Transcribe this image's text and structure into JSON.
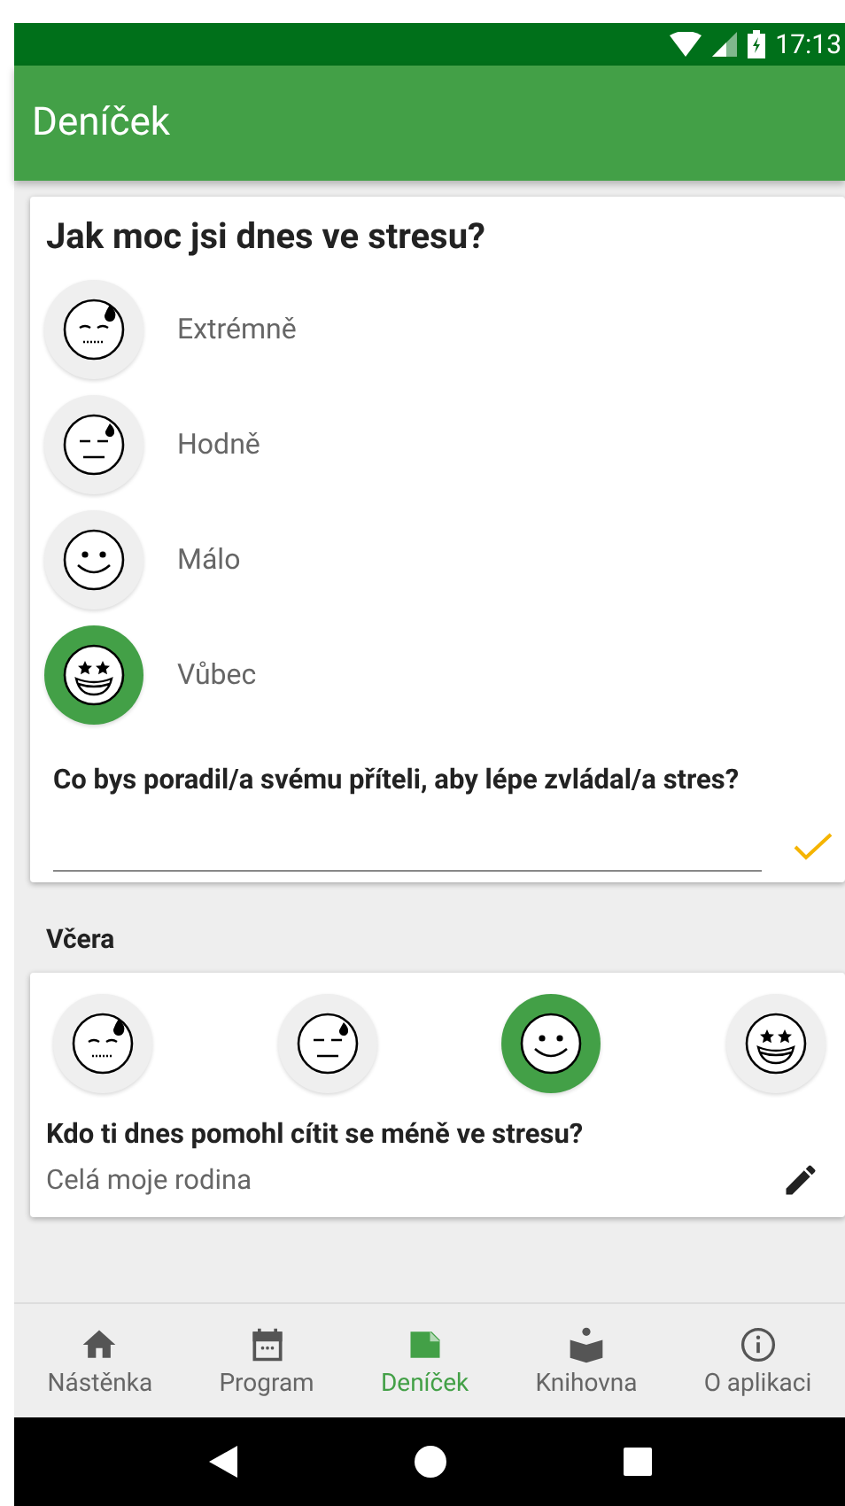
{
  "status_bar": {
    "time": "17:13"
  },
  "app_bar": {
    "title": "Deníček"
  },
  "today": {
    "question": "Jak moc jsi dnes ve stresu?",
    "options": [
      {
        "kind": "extreme",
        "label": "Extrémně",
        "selected": false
      },
      {
        "kind": "high",
        "label": "Hodně",
        "selected": false
      },
      {
        "kind": "low",
        "label": "Málo",
        "selected": false
      },
      {
        "kind": "none",
        "label": "Vůbec",
        "selected": true
      }
    ],
    "prompt": "Co bys poradil/a svému příteli, aby lépe zvládal/a stres?"
  },
  "yesterday": {
    "heading": "Včera",
    "faces": [
      {
        "kind": "extreme",
        "selected": false
      },
      {
        "kind": "high",
        "selected": false
      },
      {
        "kind": "low",
        "selected": true
      },
      {
        "kind": "none",
        "selected": false
      }
    ],
    "question": "Kdo ti dnes pomohl cítit se méně ve stresu?",
    "answer": "Celá moje rodina"
  },
  "bottom_nav": [
    {
      "kind": "home",
      "label": "Nástěnka",
      "selected": false
    },
    {
      "kind": "calendar",
      "label": "Program",
      "selected": false
    },
    {
      "kind": "note",
      "label": "Deníček",
      "selected": true
    },
    {
      "kind": "book",
      "label": "Knihovna",
      "selected": false
    },
    {
      "kind": "info",
      "label": "O aplikaci",
      "selected": false
    }
  ]
}
